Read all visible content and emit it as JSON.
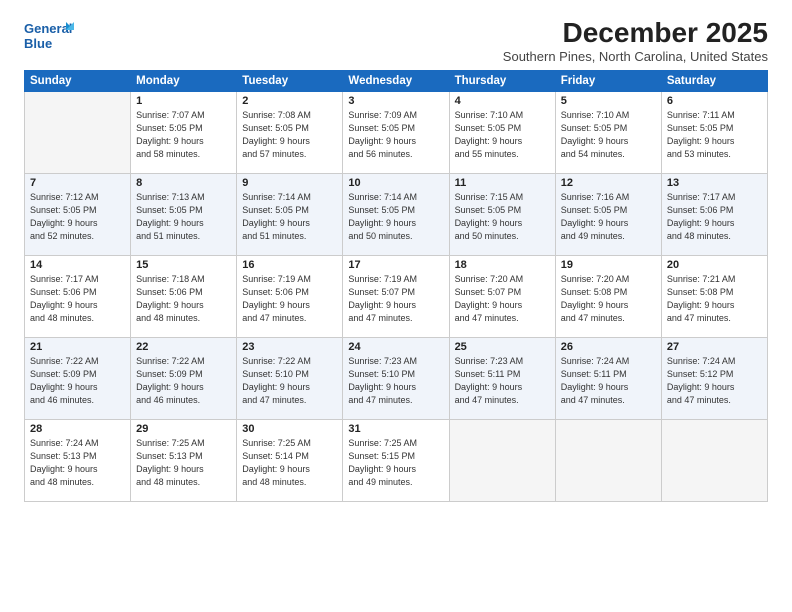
{
  "header": {
    "logo_line1": "General",
    "logo_line2": "Blue",
    "month": "December 2025",
    "location": "Southern Pines, North Carolina, United States"
  },
  "days_of_week": [
    "Sunday",
    "Monday",
    "Tuesday",
    "Wednesday",
    "Thursday",
    "Friday",
    "Saturday"
  ],
  "weeks": [
    [
      {
        "day": "",
        "info": ""
      },
      {
        "day": "1",
        "info": "Sunrise: 7:07 AM\nSunset: 5:05 PM\nDaylight: 9 hours\nand 58 minutes."
      },
      {
        "day": "2",
        "info": "Sunrise: 7:08 AM\nSunset: 5:05 PM\nDaylight: 9 hours\nand 57 minutes."
      },
      {
        "day": "3",
        "info": "Sunrise: 7:09 AM\nSunset: 5:05 PM\nDaylight: 9 hours\nand 56 minutes."
      },
      {
        "day": "4",
        "info": "Sunrise: 7:10 AM\nSunset: 5:05 PM\nDaylight: 9 hours\nand 55 minutes."
      },
      {
        "day": "5",
        "info": "Sunrise: 7:10 AM\nSunset: 5:05 PM\nDaylight: 9 hours\nand 54 minutes."
      },
      {
        "day": "6",
        "info": "Sunrise: 7:11 AM\nSunset: 5:05 PM\nDaylight: 9 hours\nand 53 minutes."
      }
    ],
    [
      {
        "day": "7",
        "info": "Sunrise: 7:12 AM\nSunset: 5:05 PM\nDaylight: 9 hours\nand 52 minutes."
      },
      {
        "day": "8",
        "info": "Sunrise: 7:13 AM\nSunset: 5:05 PM\nDaylight: 9 hours\nand 51 minutes."
      },
      {
        "day": "9",
        "info": "Sunrise: 7:14 AM\nSunset: 5:05 PM\nDaylight: 9 hours\nand 51 minutes."
      },
      {
        "day": "10",
        "info": "Sunrise: 7:14 AM\nSunset: 5:05 PM\nDaylight: 9 hours\nand 50 minutes."
      },
      {
        "day": "11",
        "info": "Sunrise: 7:15 AM\nSunset: 5:05 PM\nDaylight: 9 hours\nand 50 minutes."
      },
      {
        "day": "12",
        "info": "Sunrise: 7:16 AM\nSunset: 5:05 PM\nDaylight: 9 hours\nand 49 minutes."
      },
      {
        "day": "13",
        "info": "Sunrise: 7:17 AM\nSunset: 5:06 PM\nDaylight: 9 hours\nand 48 minutes."
      }
    ],
    [
      {
        "day": "14",
        "info": "Sunrise: 7:17 AM\nSunset: 5:06 PM\nDaylight: 9 hours\nand 48 minutes."
      },
      {
        "day": "15",
        "info": "Sunrise: 7:18 AM\nSunset: 5:06 PM\nDaylight: 9 hours\nand 48 minutes."
      },
      {
        "day": "16",
        "info": "Sunrise: 7:19 AM\nSunset: 5:06 PM\nDaylight: 9 hours\nand 47 minutes."
      },
      {
        "day": "17",
        "info": "Sunrise: 7:19 AM\nSunset: 5:07 PM\nDaylight: 9 hours\nand 47 minutes."
      },
      {
        "day": "18",
        "info": "Sunrise: 7:20 AM\nSunset: 5:07 PM\nDaylight: 9 hours\nand 47 minutes."
      },
      {
        "day": "19",
        "info": "Sunrise: 7:20 AM\nSunset: 5:08 PM\nDaylight: 9 hours\nand 47 minutes."
      },
      {
        "day": "20",
        "info": "Sunrise: 7:21 AM\nSunset: 5:08 PM\nDaylight: 9 hours\nand 47 minutes."
      }
    ],
    [
      {
        "day": "21",
        "info": "Sunrise: 7:22 AM\nSunset: 5:09 PM\nDaylight: 9 hours\nand 46 minutes."
      },
      {
        "day": "22",
        "info": "Sunrise: 7:22 AM\nSunset: 5:09 PM\nDaylight: 9 hours\nand 46 minutes."
      },
      {
        "day": "23",
        "info": "Sunrise: 7:22 AM\nSunset: 5:10 PM\nDaylight: 9 hours\nand 47 minutes."
      },
      {
        "day": "24",
        "info": "Sunrise: 7:23 AM\nSunset: 5:10 PM\nDaylight: 9 hours\nand 47 minutes."
      },
      {
        "day": "25",
        "info": "Sunrise: 7:23 AM\nSunset: 5:11 PM\nDaylight: 9 hours\nand 47 minutes."
      },
      {
        "day": "26",
        "info": "Sunrise: 7:24 AM\nSunset: 5:11 PM\nDaylight: 9 hours\nand 47 minutes."
      },
      {
        "day": "27",
        "info": "Sunrise: 7:24 AM\nSunset: 5:12 PM\nDaylight: 9 hours\nand 47 minutes."
      }
    ],
    [
      {
        "day": "28",
        "info": "Sunrise: 7:24 AM\nSunset: 5:13 PM\nDaylight: 9 hours\nand 48 minutes."
      },
      {
        "day": "29",
        "info": "Sunrise: 7:25 AM\nSunset: 5:13 PM\nDaylight: 9 hours\nand 48 minutes."
      },
      {
        "day": "30",
        "info": "Sunrise: 7:25 AM\nSunset: 5:14 PM\nDaylight: 9 hours\nand 48 minutes."
      },
      {
        "day": "31",
        "info": "Sunrise: 7:25 AM\nSunset: 5:15 PM\nDaylight: 9 hours\nand 49 minutes."
      },
      {
        "day": "",
        "info": ""
      },
      {
        "day": "",
        "info": ""
      },
      {
        "day": "",
        "info": ""
      }
    ]
  ]
}
